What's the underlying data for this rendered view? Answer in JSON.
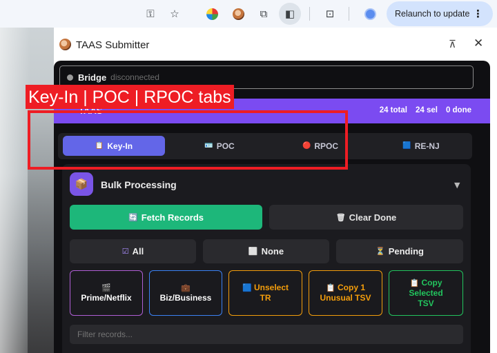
{
  "browser": {
    "icons": [
      "key-icon",
      "star-icon",
      "extension-icon",
      "puzzle-icon",
      "side-panel-icon",
      "tab-search-icon",
      "profile-icon"
    ],
    "relaunch_label": "Relaunch to update",
    "relaunch_menu": "⋮"
  },
  "side_panel": {
    "title": "TAAS Submitter",
    "pin_glyph": "📌",
    "close_glyph": "✕"
  },
  "extension": {
    "bridge": {
      "label": "Bridge",
      "status": "disconnected"
    },
    "brand": "TAAS",
    "stats": {
      "total": "24 total",
      "selected": "24 sel",
      "done": "0 done"
    },
    "tabs": [
      {
        "label": "Key-In",
        "icon": "📋",
        "active": true
      },
      {
        "label": "POC",
        "icon": "🪪",
        "active": false
      },
      {
        "label": "RPOC",
        "icon": "🔴",
        "active": false
      },
      {
        "label": "RE-NJ",
        "icon": "🟦",
        "active": false
      }
    ],
    "bulk": {
      "icon": "📦",
      "title": "Bulk Processing",
      "caret": "▼",
      "fetch": {
        "icon": "🔄",
        "label": "Fetch Records"
      },
      "clear": {
        "icon": "🗑",
        "label": "Clear Done"
      },
      "select_all": {
        "icon": "☑",
        "label": "All"
      },
      "select_none": {
        "icon": "⬜",
        "label": "None"
      },
      "select_pending": {
        "icon": "⏳",
        "label": "Pending"
      },
      "actions": [
        {
          "icon": "🎬",
          "label": "Prime/Netflix",
          "color": "#b15fd6"
        },
        {
          "icon": "💼",
          "label": "Biz/Business",
          "color": "#3b82f6"
        },
        {
          "icon": "🟦",
          "label": "Unselect TR",
          "color": "#f59e0b"
        },
        {
          "icon": "📋",
          "label": "Copy 1 Unusual TSV",
          "color": "#f59e0b"
        },
        {
          "icon": "📋",
          "label": "Copy Selected TSV",
          "color": "#22c55e"
        }
      ],
      "filter_placeholder": "Filter records..."
    }
  },
  "annotation": {
    "label": "Key-In | POC | RPOC tabs",
    "color": "#ee1d24"
  }
}
